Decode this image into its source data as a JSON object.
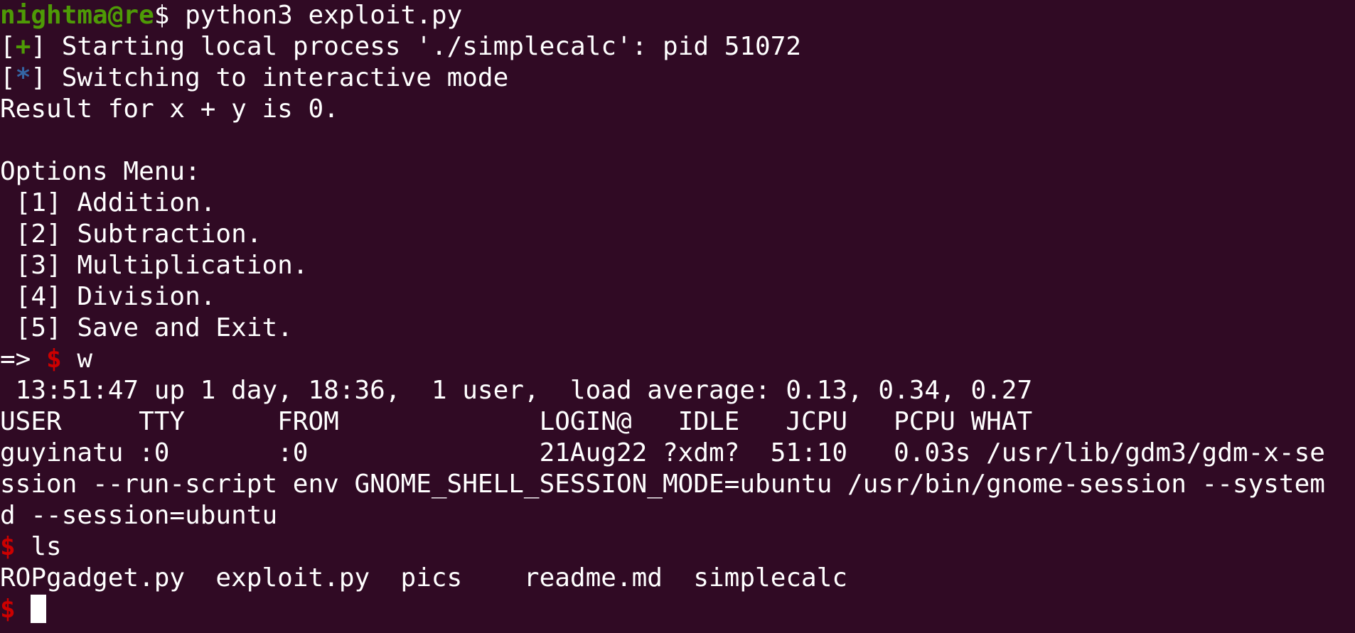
{
  "prompt": {
    "user_host": "nightma@re",
    "dollar": "$",
    "command": " python3 exploit.py"
  },
  "process_start": {
    "open": "[",
    "marker": "+",
    "close": "]",
    "text": " Starting local process './simplecalc': pid 51072"
  },
  "interactive": {
    "open": "[",
    "marker": "*",
    "close": "]",
    "text": " Switching to interactive mode"
  },
  "result_line": "Result for x + y is 0.",
  "options": {
    "title": "Options Menu:",
    "items": [
      " [1] Addition.",
      " [2] Subtraction.",
      " [3] Multiplication.",
      " [4] Division.",
      " [5] Save and Exit."
    ]
  },
  "shell_w": {
    "arrow": "=> ",
    "dollar": "$",
    "command": " w"
  },
  "w_output": {
    "uptime": " 13:51:47 up 1 day, 18:36,  1 user,  load average: 0.13, 0.34, 0.27",
    "header": "USER     TTY      FROM             LOGIN@   IDLE   JCPU   PCPU WHAT",
    "row1": "guyinatu :0       :0               21Aug22 ?xdm?  51:10   0.03s /usr/lib/gdm3/gdm-x-se",
    "row2": "ssion --run-script env GNOME_SHELL_SESSION_MODE=ubuntu /usr/bin/gnome-session --system",
    "row3": "d --session=ubuntu"
  },
  "shell_ls": {
    "dollar": "$",
    "command": " ls"
  },
  "ls_output": "ROPgadget.py  exploit.py  pics    readme.md  simplecalc",
  "final_prompt": {
    "dollar": "$",
    "space": " "
  }
}
